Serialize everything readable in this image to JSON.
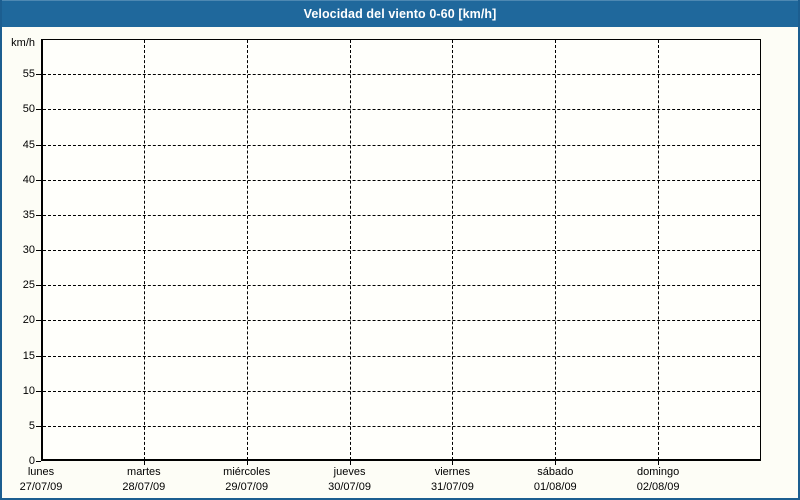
{
  "title_bar": {
    "title": "Velocidad del viento 0-60 [km/h]"
  },
  "colors": {
    "title_bar_bg": "#1f689c",
    "title_bar_highlight": "#4d88b2",
    "title_text": "#ffffff",
    "outer_border": "#1c5e90",
    "page_bg": "#fdfdf6",
    "plot_bg": "#fffffb",
    "axis": "#000000",
    "grid": "#000000",
    "label_text": "#000000"
  },
  "chart_data": {
    "type": "line",
    "title": "Velocidad del viento 0-60 [km/h]",
    "ylabel": "km/h",
    "ylim": [
      0,
      60
    ],
    "ytick_interval": 5,
    "yticks": [
      0,
      5,
      10,
      15,
      20,
      25,
      30,
      35,
      40,
      45,
      50,
      55
    ],
    "grid": "dashed-both-axes",
    "legend": "none",
    "x_categories": [
      {
        "day": "lunes",
        "date": "27/07/09"
      },
      {
        "day": "martes",
        "date": "28/07/09"
      },
      {
        "day": "miércoles",
        "date": "29/07/09"
      },
      {
        "day": "jueves",
        "date": "30/07/09"
      },
      {
        "day": "viernes",
        "date": "31/07/09"
      },
      {
        "day": "sábado",
        "date": "01/08/09"
      },
      {
        "day": "domingo",
        "date": "02/08/09"
      }
    ],
    "series": []
  }
}
